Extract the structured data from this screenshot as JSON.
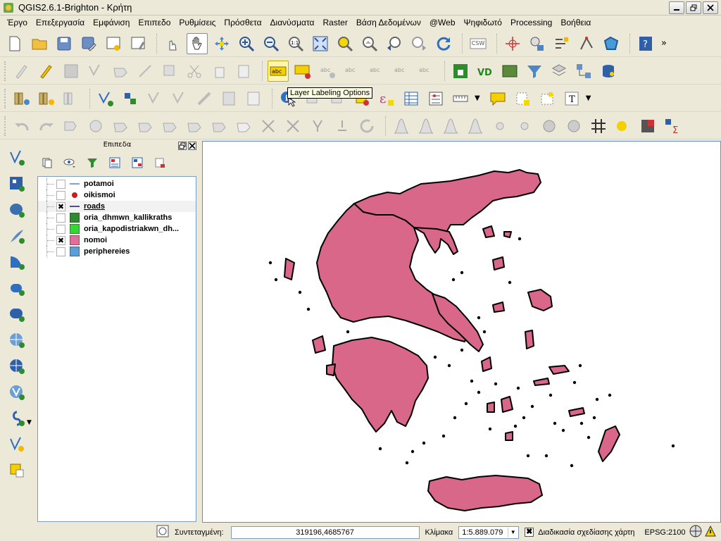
{
  "window": {
    "title": "QGIS2.6.1-Brighton - Κρήτη"
  },
  "menu": [
    "Έργο",
    "Επεξεργασία",
    "Εμφάνιση",
    "Επιπεδο",
    "Ρυθμίσεις",
    "Πρόσθετα",
    "Διανύσματα",
    "Raster",
    "Βάση Δεδομένων",
    "@Web",
    "Ψηφιδωτό",
    "Processing",
    "Βοήθεια"
  ],
  "toolbar": {
    "tooltip": "Layer Labeling Options",
    "csw_label": "CSW",
    "overflow": "»"
  },
  "layers_panel": {
    "title": "Επιπεδα",
    "layers": [
      {
        "name": "potamoi",
        "checked": false,
        "symbol": "line",
        "color": "#4a86c8"
      },
      {
        "name": "oikismoi",
        "checked": false,
        "symbol": "point",
        "color": "#c81e1e"
      },
      {
        "name": "roads",
        "checked": true,
        "symbol": "line",
        "color": "#1a1a60",
        "selected": true
      },
      {
        "name": "oria_dhmwn_kallikraths",
        "checked": false,
        "symbol": "fill",
        "color": "#2e8b2e"
      },
      {
        "name": "oria_kapodistriakwn_dh...",
        "checked": false,
        "symbol": "fill",
        "color": "#33d633"
      },
      {
        "name": "nomoi",
        "checked": true,
        "symbol": "fill",
        "color": "#e0709a"
      },
      {
        "name": "periphereies",
        "checked": false,
        "symbol": "fill",
        "color": "#5aa0d8"
      }
    ]
  },
  "status": {
    "coord_label": "Συντεταγμένη:",
    "coord_value": "319196,4685767",
    "scale_label": "Κλίμακα",
    "scale_value": "1:5.889.079",
    "render_label": "Διαδικασία σχεδίασης χάρτη",
    "render_checked": true,
    "crs": "EPSG:2100"
  },
  "colors": {
    "land_fill": "#d9678a",
    "land_outline": "#000000",
    "map_frame": "#5a8ee6"
  }
}
